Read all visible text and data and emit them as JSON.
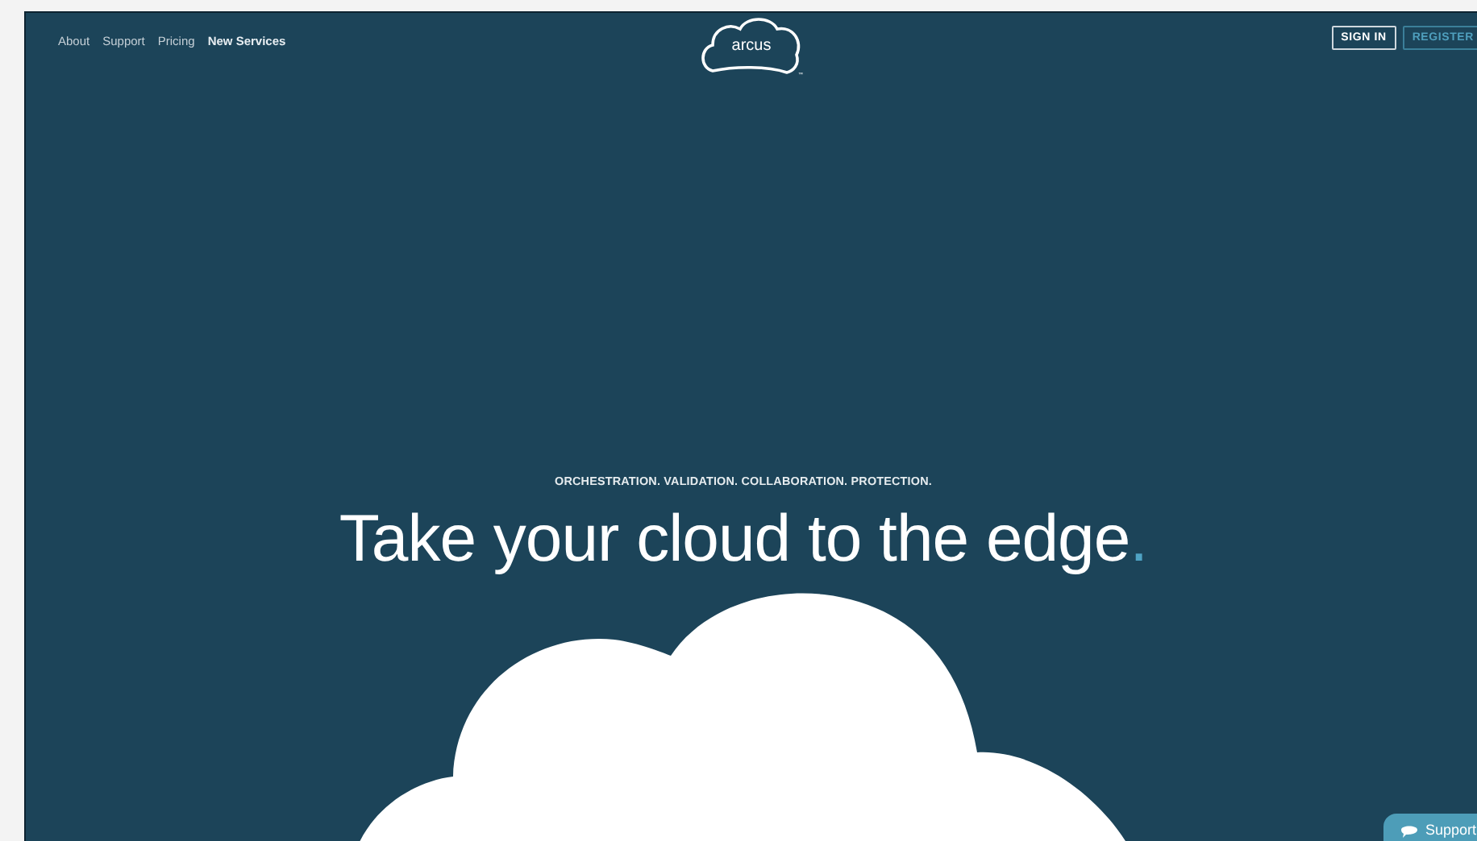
{
  "nav": [
    {
      "label": "About",
      "selected": false
    },
    {
      "label": "Support",
      "selected": false
    },
    {
      "label": "Pricing",
      "selected": false
    },
    {
      "label": "New Services",
      "selected": true
    }
  ],
  "logo": {
    "text": "arcus",
    "mark": "™"
  },
  "account_buttons": [
    {
      "label": "SIGN IN",
      "kind": "outline"
    },
    {
      "label": "REGISTER",
      "kind": "accent"
    }
  ],
  "hero": {
    "tagline": "ORCHESTRATION. VALIDATION. COLLABORATION. PROTECTION.",
    "headline": "Take your cloud to the edge",
    "accent": "."
  },
  "support_button": {
    "label": "Support"
  }
}
